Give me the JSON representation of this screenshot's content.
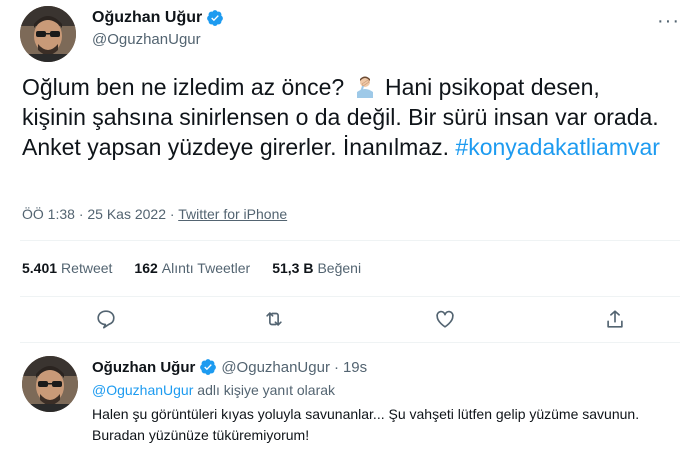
{
  "tweet": {
    "display_name": "Oğuzhan Uğur",
    "handle": "@OguzhanUgur",
    "text_part1": "Oğlum ben ne izledim az önce? ",
    "text_part2": " Hani psikopat desen, kişinin şahsına sinirlensen o da değil. Bir sürü insan var orada. Anket yapsan yüzdeye girerler. İnanılmaz. ",
    "hashtag": "#konyadakatliamvar",
    "emoji": "facepalm-emoji",
    "time": "ÖÖ 1:38",
    "date": "25 Kas 2022",
    "source": "Twitter for iPhone",
    "separator": "·"
  },
  "stats": {
    "retweets_count": "5.401",
    "retweets_label": "Retweet",
    "quotes_count": "162",
    "quotes_label": "Alıntı Tweetler",
    "likes_count": "51,3 B",
    "likes_label": "Beğeni"
  },
  "actions": [
    {
      "name": "reply",
      "icon": "reply-icon"
    },
    {
      "name": "retweet",
      "icon": "retweet-icon"
    },
    {
      "name": "like",
      "icon": "heart-icon"
    },
    {
      "name": "share",
      "icon": "share-icon"
    }
  ],
  "reply": {
    "display_name": "Oğuzhan Uğur",
    "handle": "@OguzhanUgur",
    "separator": "·",
    "age": "19s",
    "reply_to_mention": "@OguzhanUgur",
    "reply_to_suffix": " adlı kişiye yanıt olarak",
    "text": "Halen şu görüntüleri kıyas yoluyla savunanlar... Şu vahşeti lütfen gelip yüzüme savunun. Buradan yüzünüze tüküremiyorum!"
  },
  "colors": {
    "accent": "#1d9bf0",
    "text": "#0f1419",
    "secondary": "#536471",
    "divider": "#eff3f4"
  }
}
